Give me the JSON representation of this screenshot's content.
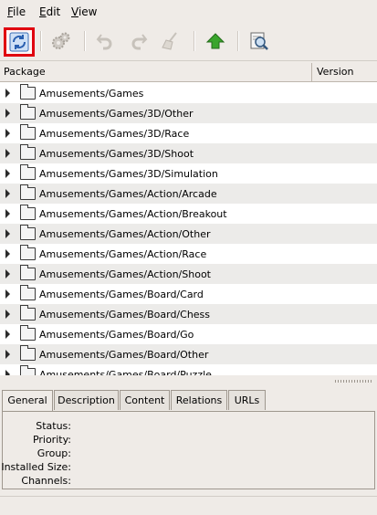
{
  "menubar": {
    "items": [
      {
        "label_u": "F",
        "label_rest": "ile"
      },
      {
        "label_u": "E",
        "label_rest": "dit"
      },
      {
        "label_u": "V",
        "label_rest": "iew"
      }
    ]
  },
  "toolbar": {
    "buttons": [
      {
        "icon": "refresh-icon",
        "enabled": true,
        "highlighted": true
      },
      {
        "icon": "gears-icon",
        "enabled": false
      },
      {
        "icon": "undo-icon",
        "enabled": false
      },
      {
        "icon": "redo-icon",
        "enabled": false
      },
      {
        "icon": "clear-broom-icon",
        "enabled": false
      },
      {
        "icon": "upgrade-arrow-icon",
        "enabled": true
      },
      {
        "icon": "search-icon",
        "enabled": true
      }
    ]
  },
  "list": {
    "columns": [
      "Package",
      "Version"
    ],
    "rows": [
      "Amusements/Games",
      "Amusements/Games/3D/Other",
      "Amusements/Games/3D/Race",
      "Amusements/Games/3D/Shoot",
      "Amusements/Games/3D/Simulation",
      "Amusements/Games/Action/Arcade",
      "Amusements/Games/Action/Breakout",
      "Amusements/Games/Action/Other",
      "Amusements/Games/Action/Race",
      "Amusements/Games/Action/Shoot",
      "Amusements/Games/Board/Card",
      "Amusements/Games/Board/Chess",
      "Amusements/Games/Board/Go",
      "Amusements/Games/Board/Other",
      "Amusements/Games/Board/Puzzle"
    ]
  },
  "tabs": [
    "General",
    "Description",
    "Content",
    "Relations",
    "URLs"
  ],
  "details": {
    "fields": [
      "Status:",
      "Priority:",
      "Group:",
      "Installed Size:",
      "Channels:"
    ]
  },
  "colors": {
    "highlight_border": "#e0000f",
    "upgrade_green": "#3aa52c"
  }
}
